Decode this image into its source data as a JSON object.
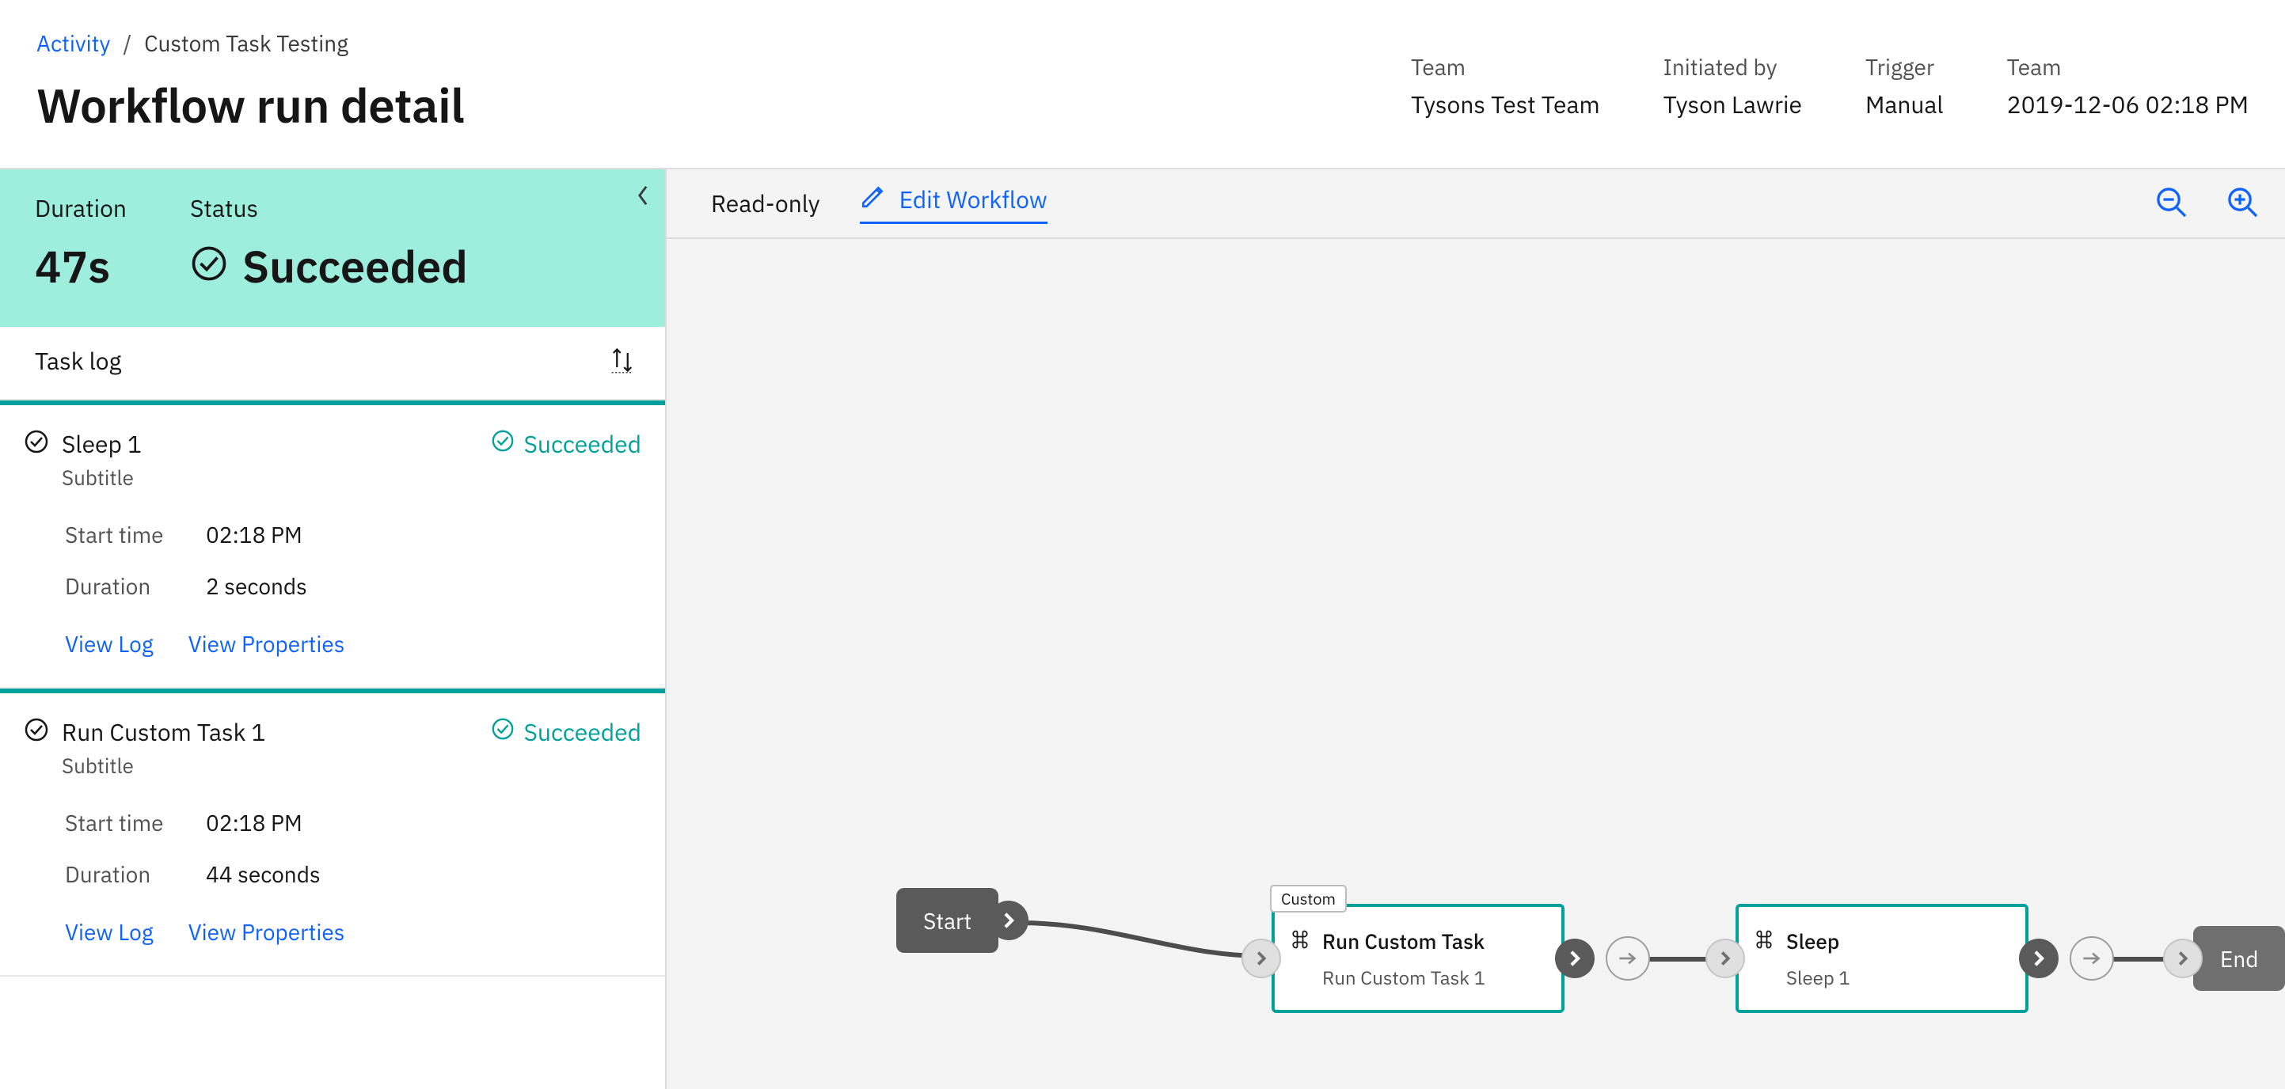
{
  "breadcrumb": {
    "root": "Activity",
    "current": "Custom Task Testing"
  },
  "page_title": "Workflow run detail",
  "meta": [
    {
      "label": "Team",
      "value": "Tysons Test Team"
    },
    {
      "label": "Initiated by",
      "value": "Tyson Lawrie"
    },
    {
      "label": "Trigger",
      "value": "Manual"
    },
    {
      "label": "Team",
      "value": "2019-12-06 02:18 PM"
    }
  ],
  "status_block": {
    "duration_label": "Duration",
    "duration_value": "47s",
    "status_label": "Status",
    "status_value": "Succeeded"
  },
  "task_log_header": "Task log",
  "tasks": [
    {
      "icon": "checkmark",
      "title": "Sleep 1",
      "subtitle": "Subtitle",
      "status": "Succeeded",
      "start_time_label": "Start time",
      "start_time": "02:18 PM",
      "duration_label": "Duration",
      "duration": "2 seconds",
      "view_log": "View Log",
      "view_properties": "View Properties"
    },
    {
      "icon": "checkmark",
      "title": "Run Custom Task 1",
      "subtitle": "Subtitle",
      "status": "Succeeded",
      "start_time_label": "Start time",
      "start_time": "02:18 PM",
      "duration_label": "Duration",
      "duration": "44 seconds",
      "view_log": "View Log",
      "view_properties": "View Properties"
    }
  ],
  "canvas_toolbar": {
    "readonly": "Read-only",
    "edit": "Edit Workflow"
  },
  "workflow": {
    "start": "Start",
    "end": "End",
    "node1": {
      "tag": "Custom",
      "title": "Run Custom Task",
      "subtitle": "Run Custom Task 1"
    },
    "node2": {
      "title": "Sleep",
      "subtitle": "Sleep 1"
    }
  }
}
